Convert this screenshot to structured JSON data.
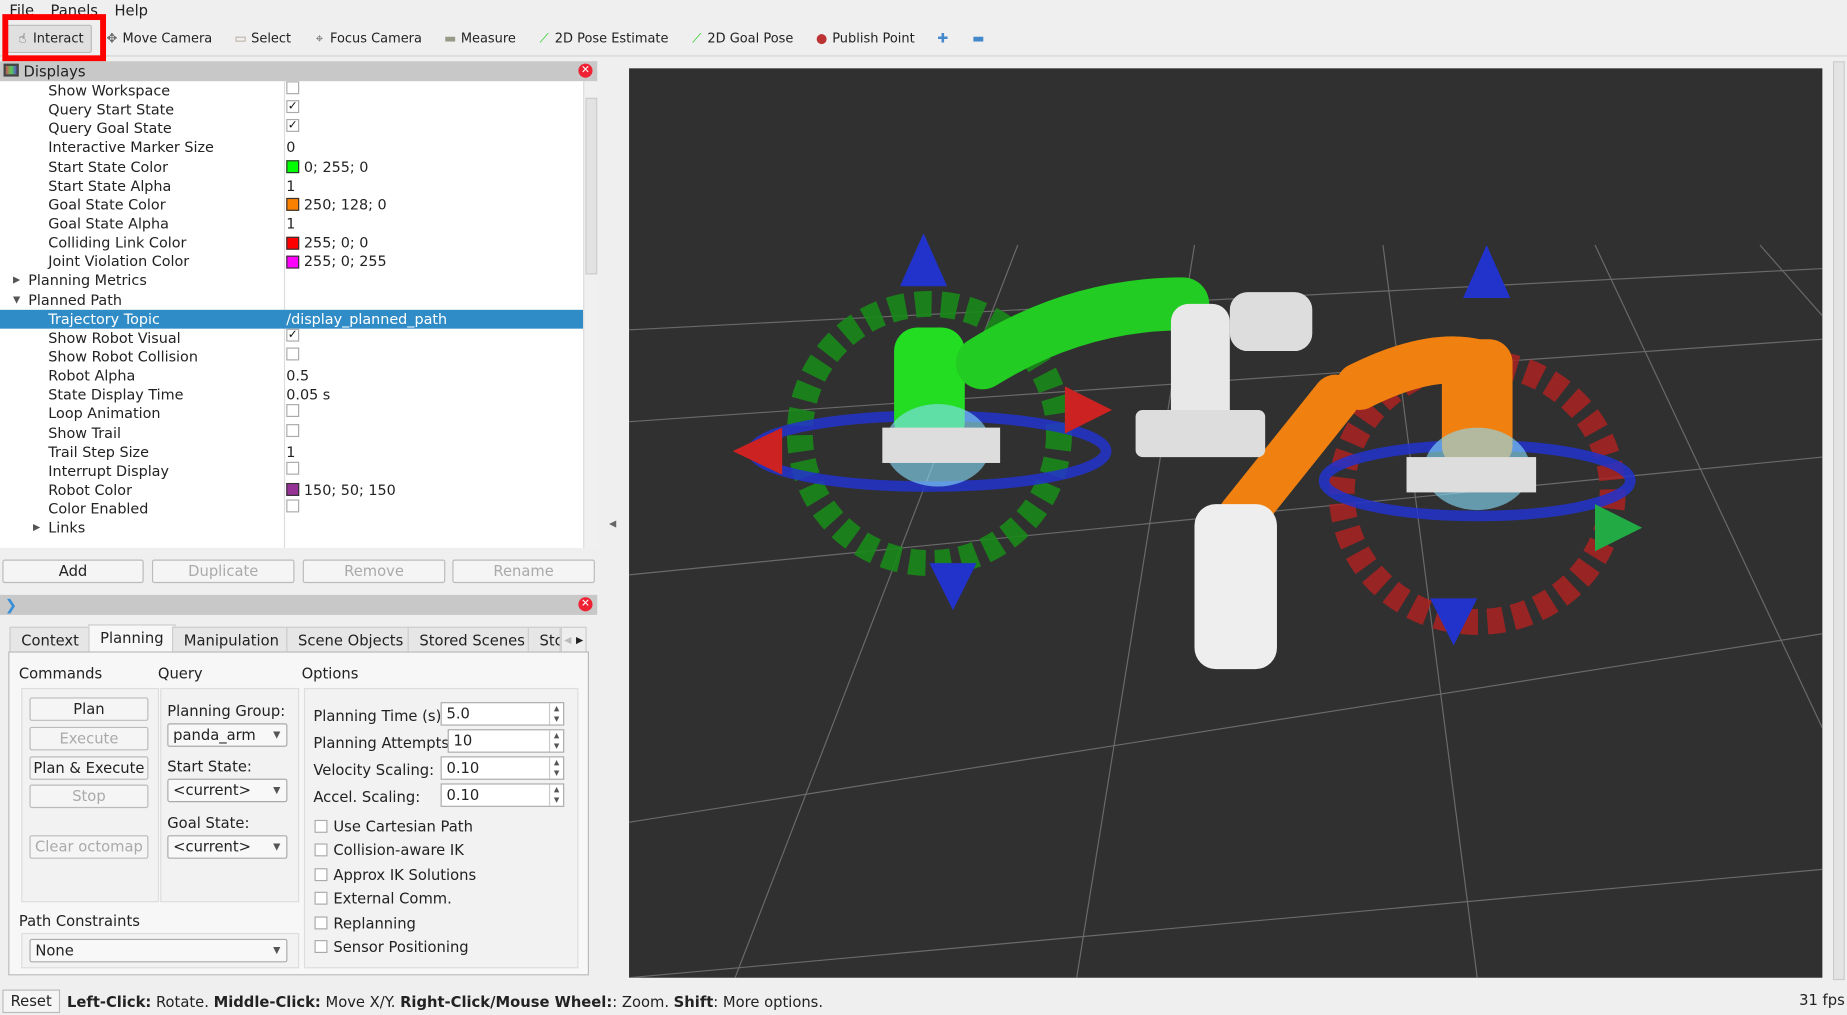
{
  "menu": [
    "File",
    "Panels",
    "Help"
  ],
  "toolbar": [
    {
      "label": "Interact",
      "icon": "hand-icon",
      "glyph": "☝",
      "color": "#444",
      "active": true
    },
    {
      "label": "Move Camera",
      "icon": "move-camera-icon",
      "glyph": "✥",
      "color": "#666"
    },
    {
      "label": "Select",
      "icon": "select-icon",
      "glyph": "▭",
      "color": "#a98"
    },
    {
      "label": "Focus Camera",
      "icon": "focus-camera-icon",
      "glyph": "⌖",
      "color": "#666"
    },
    {
      "label": "Measure",
      "icon": "ruler-icon",
      "glyph": "▬",
      "color": "#998"
    },
    {
      "label": "2D Pose Estimate",
      "icon": "pose-estimate-arrow-icon",
      "glyph": "⟋",
      "color": "#2c2"
    },
    {
      "label": "2D Goal Pose",
      "icon": "goal-pose-arrow-icon",
      "glyph": "⟋",
      "color": "#2c2"
    },
    {
      "label": "Publish Point",
      "icon": "map-pin-icon",
      "glyph": "●",
      "color": "#b33"
    },
    {
      "label": "",
      "icon": "plus-icon",
      "glyph": "✚",
      "color": "#48c"
    },
    {
      "label": "",
      "icon": "minus-icon",
      "glyph": "▬",
      "color": "#48c"
    }
  ],
  "displays": {
    "title": "Displays",
    "rows": [
      {
        "label": "Show Workspace",
        "indent": 2,
        "check": false
      },
      {
        "label": "Query Start State",
        "indent": 2,
        "check": true
      },
      {
        "label": "Query Goal State",
        "indent": 2,
        "check": true
      },
      {
        "label": "Interactive Marker Size",
        "indent": 2,
        "value": "0"
      },
      {
        "label": "Start State Color",
        "indent": 2,
        "value": "0; 255; 0",
        "swatch": "#00ff00"
      },
      {
        "label": "Start State Alpha",
        "indent": 2,
        "value": "1"
      },
      {
        "label": "Goal State Color",
        "indent": 2,
        "value": "250; 128; 0",
        "swatch": "#fa8000"
      },
      {
        "label": "Goal State Alpha",
        "indent": 2,
        "value": "1"
      },
      {
        "label": "Colliding Link Color",
        "indent": 2,
        "value": "255; 0; 0",
        "swatch": "#ff0000"
      },
      {
        "label": "Joint Violation Color",
        "indent": 2,
        "value": "255; 0; 255",
        "swatch": "#ff00ff"
      },
      {
        "label": "Planning Metrics",
        "indent": 1,
        "expand": "collapsed"
      },
      {
        "label": "Planned Path",
        "indent": 1,
        "expand": "expanded"
      },
      {
        "label": "Trajectory Topic",
        "indent": 2,
        "value": "/display_planned_path",
        "selected": true
      },
      {
        "label": "Show Robot Visual",
        "indent": 2,
        "check": true
      },
      {
        "label": "Show Robot Collision",
        "indent": 2,
        "check": false
      },
      {
        "label": "Robot Alpha",
        "indent": 2,
        "value": "0.5"
      },
      {
        "label": "State Display Time",
        "indent": 2,
        "value": "0.05 s"
      },
      {
        "label": "Loop Animation",
        "indent": 2,
        "check": false
      },
      {
        "label": "Show Trail",
        "indent": 2,
        "check": false
      },
      {
        "label": "Trail Step Size",
        "indent": 2,
        "value": "1"
      },
      {
        "label": "Interrupt Display",
        "indent": 2,
        "check": false
      },
      {
        "label": "Robot Color",
        "indent": 2,
        "value": "150; 50; 150",
        "swatch": "#963296"
      },
      {
        "label": "Color Enabled",
        "indent": 2,
        "check": false
      },
      {
        "label": "Links",
        "indent": 2,
        "expand": "collapsed"
      }
    ],
    "buttons": {
      "add": "Add",
      "duplicate": "Duplicate",
      "remove": "Remove",
      "rename": "Rename"
    }
  },
  "motion_planning": {
    "tabs": [
      "Context",
      "Planning",
      "Manipulation",
      "Scene Objects",
      "Stored Scenes",
      "Stc"
    ],
    "active_tab": "Planning",
    "commands": {
      "title": "Commands",
      "plan": "Plan",
      "execute": "Execute",
      "plan_execute": "Plan & Execute",
      "stop": "Stop",
      "clear_octomap": "Clear octomap"
    },
    "query": {
      "title": "Query",
      "planning_group_label": "Planning Group:",
      "planning_group": "panda_arm",
      "start_state_label": "Start State:",
      "start_state": "<current>",
      "goal_state_label": "Goal State:",
      "goal_state": "<current>"
    },
    "options": {
      "title": "Options",
      "planning_time_label": "Planning Time (s):",
      "planning_time": "5.0",
      "planning_attempts_label": "Planning Attempts:",
      "planning_attempts": "10",
      "velocity_scaling_label": "Velocity Scaling:",
      "velocity_scaling": "0.10",
      "accel_scaling_label": "Accel. Scaling:",
      "accel_scaling": "0.10",
      "checks": [
        {
          "label": "Use Cartesian Path",
          "checked": false
        },
        {
          "label": "Collision-aware IK",
          "checked": false
        },
        {
          "label": "Approx IK Solutions",
          "checked": false
        },
        {
          "label": "External Comm.",
          "checked": false
        },
        {
          "label": "Replanning",
          "checked": false
        },
        {
          "label": "Sensor Positioning",
          "checked": false
        }
      ]
    },
    "path_constraints": {
      "title": "Path Constraints",
      "value": "None"
    }
  },
  "status": {
    "reset": "Reset",
    "parts": [
      [
        "Left-Click:",
        " Rotate. "
      ],
      [
        "Middle-Click:",
        " Move X/Y. "
      ],
      [
        "Right-Click/Mouse Wheel:",
        ": Zoom. "
      ],
      [
        "Shift",
        ": More options."
      ]
    ],
    "fps": "31 fps"
  },
  "colors": {
    "selection": "#308cc6",
    "viewport_bg": "#303030",
    "highlight_box": "#ff0000",
    "start_state": "#00ff00",
    "goal_state": "#fa8000"
  }
}
